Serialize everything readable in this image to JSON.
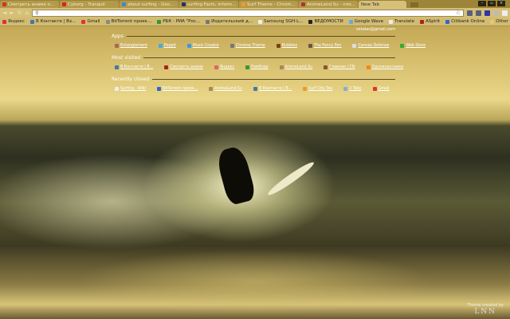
{
  "tabs": [
    {
      "label": "Смотреть аниме о...",
      "color": "#c33"
    },
    {
      "label": "Cyborg - Tranquil",
      "color": "#d22"
    },
    {
      "label": "about surfing - Goo...",
      "color": "#48c"
    },
    {
      "label": "surfing Facts, inform...",
      "color": "#236"
    },
    {
      "label": "Surf Theme - Chrom...",
      "color": "#e93"
    },
    {
      "label": "AnimeLand.Su - пло...",
      "color": "#a33"
    },
    {
      "label": "New Tab",
      "color": "#d7c07a",
      "active": true
    }
  ],
  "toolbar": {
    "address": "",
    "back": "◄",
    "forward": "►",
    "reload": "↻",
    "home": "⌂",
    "star": "☆"
  },
  "bookmarks": [
    {
      "label": "Яндекс",
      "color": "#d33"
    },
    {
      "label": "В Контакте | Вх...",
      "color": "#47a"
    },
    {
      "label": "Gmail",
      "color": "#d33"
    },
    {
      "label": "BitTorrent проек...",
      "color": "#888"
    },
    {
      "label": "РБК - РИА \"Рос...",
      "color": "#393"
    },
    {
      "label": "Издательский д...",
      "color": "#777"
    },
    {
      "label": "Samsung SGH-L...",
      "color": "#eee"
    },
    {
      "label": "ВЕДОМОСТИ",
      "color": "#222"
    },
    {
      "label": "Google Wave",
      "color": "#6ad"
    },
    {
      "label": "Translate",
      "color": "#eee"
    },
    {
      "label": "ASpirit",
      "color": "#a22"
    },
    {
      "label": "Citibank Online",
      "color": "#36c"
    }
  ],
  "other_bookmarks": "Other bookmarks",
  "ntp": {
    "email": "vetalas@gmail.com",
    "apps_title": "Apps",
    "apps": [
      {
        "label": "Entanglement",
        "color": "#a65"
      },
      {
        "label": "Poppit",
        "color": "#4ad"
      },
      {
        "label": "Music Creator",
        "color": "#39e"
      },
      {
        "label": "Chrome Theme",
        "color": "#777"
      },
      {
        "label": "Bubbles",
        "color": "#741"
      },
      {
        "label": "The Fancy Pen",
        "color": "#654"
      },
      {
        "label": "Canvas Defense",
        "color": "#ddd"
      },
      {
        "label": "Web Store",
        "color": "#3a3"
      }
    ],
    "most_visited_title": "Most visited",
    "most_visited": [
      {
        "label": "В Контакте | В...",
        "color": "#47a"
      },
      {
        "label": "Смотреть аниме",
        "color": "#a22"
      },
      {
        "label": "Яндекс",
        "color": "#d66"
      },
      {
        "label": "Рамблер",
        "color": "#393"
      },
      {
        "label": "AnimeLand.Su",
        "color": "#a85"
      },
      {
        "label": "Главная | CN",
        "color": "#853"
      },
      {
        "label": "Одноклассники",
        "color": "#e82"
      }
    ],
    "recently_closed_title": "Recently closed",
    "recently_closed": [
      {
        "label": "Surfing - Wiki",
        "color": "#eee"
      },
      {
        "label": "BitTorrent проек...",
        "color": "#36c"
      },
      {
        "label": "AnimeLand.Su",
        "color": "#a85"
      },
      {
        "label": "В Контакте | В...",
        "color": "#47a"
      },
      {
        "label": "Surf City Tee",
        "color": "#e93"
      },
      {
        "label": "2 Tabs",
        "color": "#8ad"
      },
      {
        "label": "Gmail",
        "color": "#d33"
      }
    ]
  },
  "credit": {
    "text": "Theme created by",
    "logo": "LNN"
  }
}
